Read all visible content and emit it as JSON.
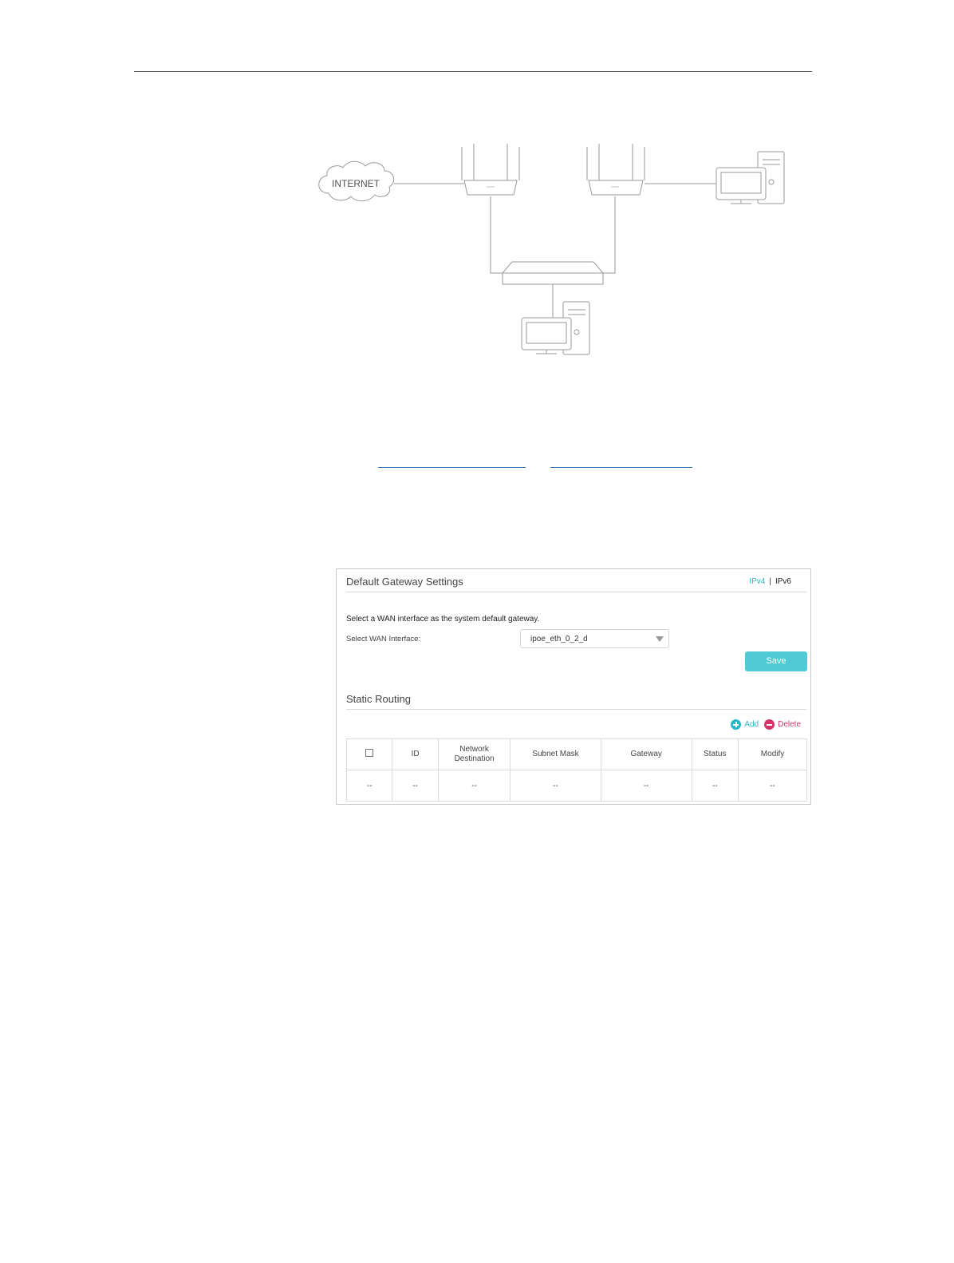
{
  "diagram": {
    "cloud_label": "INTERNET"
  },
  "panel": {
    "title": "Default Gateway Settings",
    "tabs": [
      "IPv4",
      "IPv6"
    ],
    "tab_separator": "|",
    "description": "Select a WAN interface as the system default gateway.",
    "wan_label": "Select WAN Interface:",
    "wan_value": "ipoe_eth_0_2_d",
    "save_label": "Save",
    "static_routing_title": "Static Routing",
    "add_label": "Add",
    "delete_label": "Delete",
    "table": {
      "headers": [
        "",
        "ID",
        "Network Destination",
        "Subnet Mask",
        "Gateway",
        "Status",
        "Modify"
      ],
      "rows": [
        [
          "--",
          "--",
          "--",
          "--",
          "--",
          "--",
          "--"
        ]
      ]
    }
  },
  "colors": {
    "accent": "#2bb6c8",
    "save_button": "#4fcad6",
    "delete": "#d6336c"
  }
}
